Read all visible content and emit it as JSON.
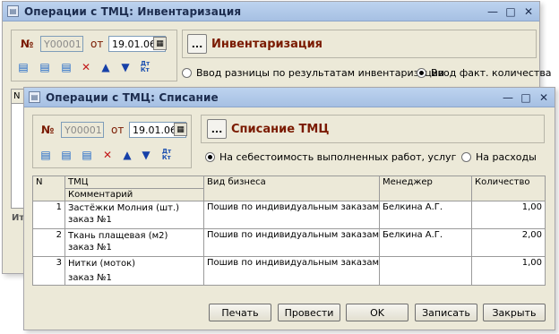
{
  "back_window": {
    "title": "Операции с ТМЦ: Инвентаризация",
    "doc_number": "Y00001",
    "label_no": "№",
    "label_from": "от",
    "date": "19.01.06",
    "dots_label": "...",
    "operation_title": "Инвентаризация",
    "radio_diff": "Ввод разницы по результатам инвентаризации",
    "radio_actual": "Ввод факт. количества",
    "radio_selected": "radio_actual",
    "partial_header": "N",
    "partial_label": "Ит"
  },
  "front_window": {
    "title": "Операции с ТМЦ: Списание",
    "doc_number": "Y00001",
    "label_no": "№",
    "label_from": "от",
    "date": "19.01.06",
    "dots_label": "...",
    "operation_title": "Списание ТМЦ",
    "radio_cost": "На себестоимость выполненных работ, услуг",
    "radio_expenses": "На расходы",
    "radio_selected": "radio_cost",
    "table": {
      "headers": {
        "n": "N",
        "item": "ТМЦ",
        "comment": "Комментарий",
        "business": "Вид бизнеса",
        "manager": "Менеджер",
        "quantity": "Количество"
      },
      "rows": [
        {
          "n": "1",
          "item": "Застёжки Молния (шт.)",
          "comment": "заказ №1",
          "business": "Пошив по индивидуальным заказам",
          "manager": "Белкина А.Г.",
          "quantity": "1,00"
        },
        {
          "n": "2",
          "item": "Ткань плащевая (м2)",
          "comment": "заказ №1",
          "business": "Пошив по индивидуальным заказам",
          "manager": "Белкина А.Г.",
          "quantity": "2,00"
        },
        {
          "n": "3",
          "item": "Нитки (моток)",
          "comment": "заказ №1",
          "business": "Пошив по индивидуальным заказам",
          "manager": "",
          "quantity": "1,00"
        }
      ]
    },
    "buttons": {
      "print": "Печать",
      "post": "Провести",
      "ok": "OK",
      "save": "Записать",
      "close": "Закрыть"
    }
  },
  "window_controls": {
    "minimize": "—",
    "maximize": "□",
    "close": "✕"
  },
  "icons": [
    "add-row-icon",
    "copy-row-icon",
    "edit-row-icon",
    "delete-row-icon",
    "move-up-icon",
    "move-down-icon",
    "dt-kt-icon"
  ],
  "colors": {
    "title_accent": "#7a1a00",
    "titlebar": "#b3cbea",
    "window_bg": "#ece9d8"
  }
}
